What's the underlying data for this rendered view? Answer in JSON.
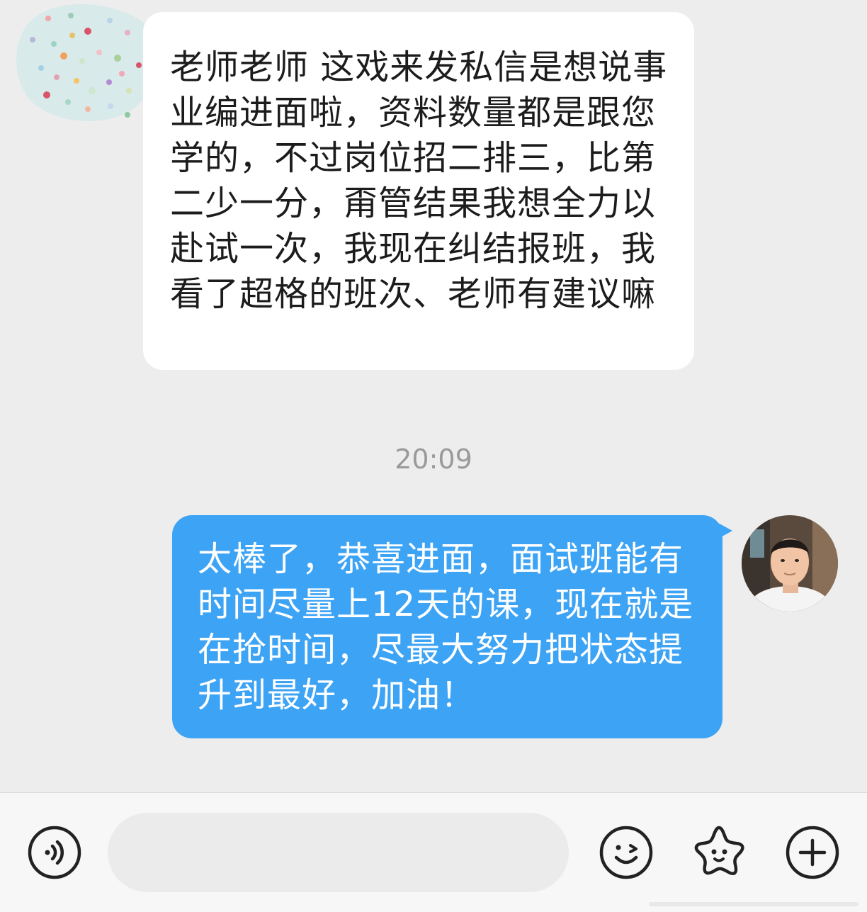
{
  "messages": [
    {
      "direction": "incoming",
      "text": "老师老师 这戏来发私信是想说事业编进面啦，资料数量都是跟您学的，不过岗位招二排三，比第二少一分，甭管结果我想全力以赴试一次，我现在纠结报班，我看了超格的班次、老师有建议嘛"
    },
    {
      "direction": "outgoing",
      "text": "太棒了，恭喜进面，面试班能有时间尽量上12天的课，现在就是在抢时间，尽最大努力把状态提升到最好，加油！"
    }
  ],
  "timestamp": "20:09",
  "input_bar": {
    "placeholder": "",
    "voice_icon": "voice-icon",
    "emoji_icon": "emoji-icon",
    "sticker_icon": "favorite-sticker-icon",
    "plus_icon": "plus-icon"
  },
  "colors": {
    "background": "#ededed",
    "incoming_bubble": "#ffffff",
    "outgoing_bubble": "#3da3f5",
    "timestamp": "#9a9a9a"
  }
}
